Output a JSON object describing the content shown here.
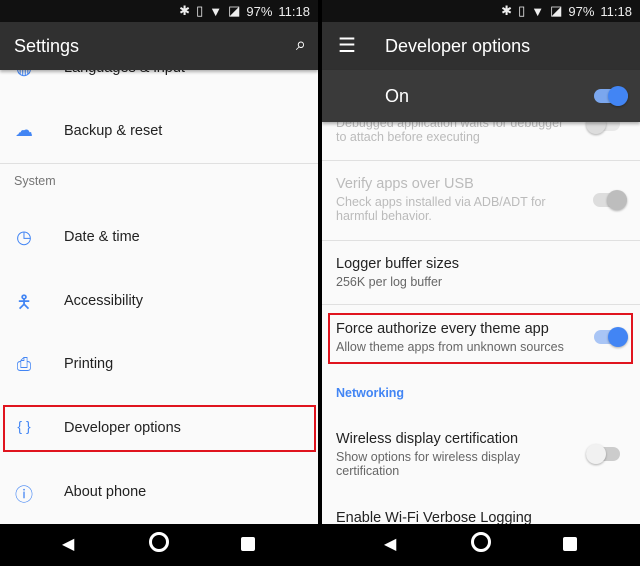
{
  "status": {
    "battery": "97%",
    "time": "11:18"
  },
  "left": {
    "title": "Settings",
    "items": [
      {
        "label": "Languages & input",
        "icon": "globe-icon"
      },
      {
        "label": "Backup & reset",
        "icon": "cloud-upload-icon"
      },
      {
        "label": "Date & time",
        "icon": "clock-icon"
      },
      {
        "label": "Accessibility",
        "icon": "accessibility-icon"
      },
      {
        "label": "Printing",
        "icon": "printer-icon"
      },
      {
        "label": "Developer options",
        "icon": "braces-icon",
        "highlighted": true
      },
      {
        "label": "About phone",
        "icon": "info-icon"
      }
    ],
    "section": "System"
  },
  "right": {
    "title": "Developer options",
    "master": {
      "label": "On",
      "on": true
    },
    "items": [
      {
        "sub": "Debugged application waits for debugger",
        "sub2": "to attach before executing",
        "enabled": false,
        "on": false
      },
      {
        "title": "Verify apps over USB",
        "sub": "Check apps installed via ADB/ADT for",
        "sub2": "harmful behavior.",
        "enabled": false,
        "on": true
      },
      {
        "title": "Logger buffer sizes",
        "sub": "256K per log buffer"
      },
      {
        "title": "Force authorize every theme app",
        "sub": "Allow theme apps from unknown sources",
        "on": true,
        "highlighted": true
      },
      {
        "title": "Wireless display certification",
        "sub": "Show options for wireless display",
        "sub2": "certification",
        "on": false
      },
      {
        "title": "Enable Wi-Fi Verbose Logging"
      }
    ],
    "section": "Networking"
  },
  "colors": {
    "accent": "#4285f4",
    "highlight": "#e0141e",
    "toolbar": "#303030"
  }
}
